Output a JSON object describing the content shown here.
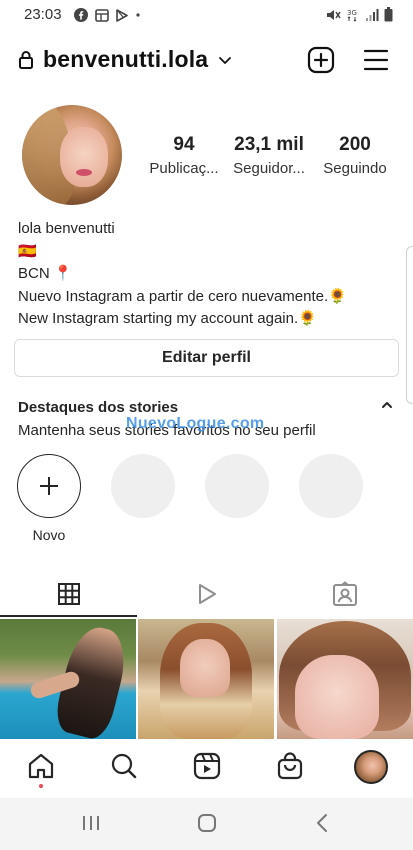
{
  "status_bar": {
    "time": "23:03",
    "left_icons": [
      "facebook-icon",
      "gallery-icon",
      "play-store-icon",
      "dot-icon"
    ],
    "right_icons": [
      "mute-icon",
      "network-3g-icon",
      "signal-icon",
      "battery-icon"
    ]
  },
  "header": {
    "username": "benvenutti.lola",
    "icons": [
      "lock-icon",
      "chevron-down-icon",
      "add-post-icon",
      "menu-icon"
    ]
  },
  "profile": {
    "stats": [
      {
        "value": "94",
        "label": "Publicaç..."
      },
      {
        "value": "23,1 mil",
        "label": "Seguidor..."
      },
      {
        "value": "200",
        "label": "Seguindo"
      }
    ],
    "name": "lola benvenutti",
    "bio_lines": [
      "🇪🇸",
      "BCN 📍",
      "Nuevo Instagram a partir de cero nuevamente.🌻",
      "New Instagram starting my account again.🌻"
    ],
    "edit_button": "Editar perfil"
  },
  "highlights": {
    "title": "Destaques dos stories",
    "subtitle": "Mantenha seus stories favoritos no seu perfil",
    "new_label": "Novo",
    "watermark": "NuevoLogue.com"
  },
  "tabs": [
    "grid-icon",
    "reels-icon",
    "tagged-icon"
  ],
  "bottom_nav": [
    "home-icon",
    "search-icon",
    "reels-icon",
    "shop-icon",
    "profile-avatar"
  ],
  "colors": {
    "text": "#262626",
    "border": "#dbdbdb",
    "placeholder": "#efefef",
    "notification": "#ed4956"
  }
}
